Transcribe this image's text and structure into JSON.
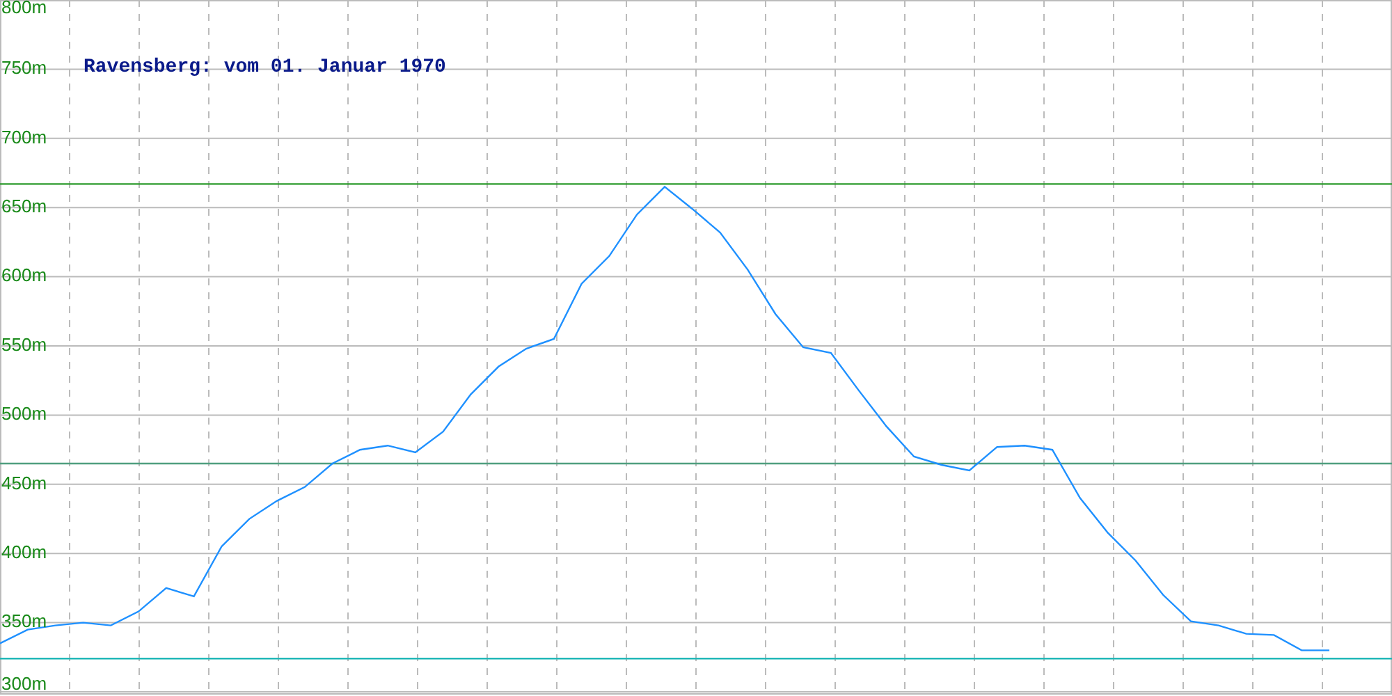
{
  "chart_data": {
    "type": "line",
    "title": "Ravensberg: vom 01. Januar 1970",
    "categories": [
      null,
      null,
      null,
      null,
      null,
      null,
      null,
      null,
      null,
      null,
      null,
      null,
      null,
      null,
      null,
      null,
      null,
      null,
      null,
      null,
      null,
      null,
      null,
      null,
      null,
      null,
      null,
      null,
      null,
      null,
      null,
      null,
      null,
      null,
      null,
      null,
      null,
      null,
      null,
      null,
      null,
      null,
      null,
      null,
      null,
      null,
      null,
      null,
      null
    ],
    "series": [
      {
        "color": "#1e90ff",
        "values": [
          335,
          345,
          348,
          350,
          348,
          358,
          375,
          369,
          405,
          425,
          438,
          448,
          465,
          475,
          478,
          473,
          488,
          515,
          535,
          548,
          555,
          595,
          615,
          645,
          665,
          649,
          632,
          605,
          573,
          549,
          545,
          518,
          492,
          470,
          464,
          460,
          477,
          478,
          475,
          440,
          415,
          395,
          370,
          351,
          348,
          342,
          341,
          330,
          330
        ]
      }
    ],
    "ylim": [
      300,
      800
    ],
    "yticks": [
      {
        "value": 300,
        "label": "300m"
      },
      {
        "value": 350,
        "label": "350m"
      },
      {
        "value": 400,
        "label": "400m"
      },
      {
        "value": 450,
        "label": "450m"
      },
      {
        "value": 500,
        "label": "500m"
      },
      {
        "value": 550,
        "label": "550m"
      },
      {
        "value": 600,
        "label": "600m"
      },
      {
        "value": 650,
        "label": "650m"
      },
      {
        "value": 700,
        "label": "700m"
      },
      {
        "value": 750,
        "label": "750m"
      },
      {
        "value": 800,
        "label": "800m"
      }
    ],
    "grid": true,
    "ref_lines": [
      {
        "axis": "y",
        "value": 667,
        "color": "#2a9a2a"
      },
      {
        "axis": "y",
        "value": 465,
        "color": "#4f9f7f"
      },
      {
        "axis": "y",
        "value": 324,
        "color": "#20b8b8"
      }
    ]
  }
}
